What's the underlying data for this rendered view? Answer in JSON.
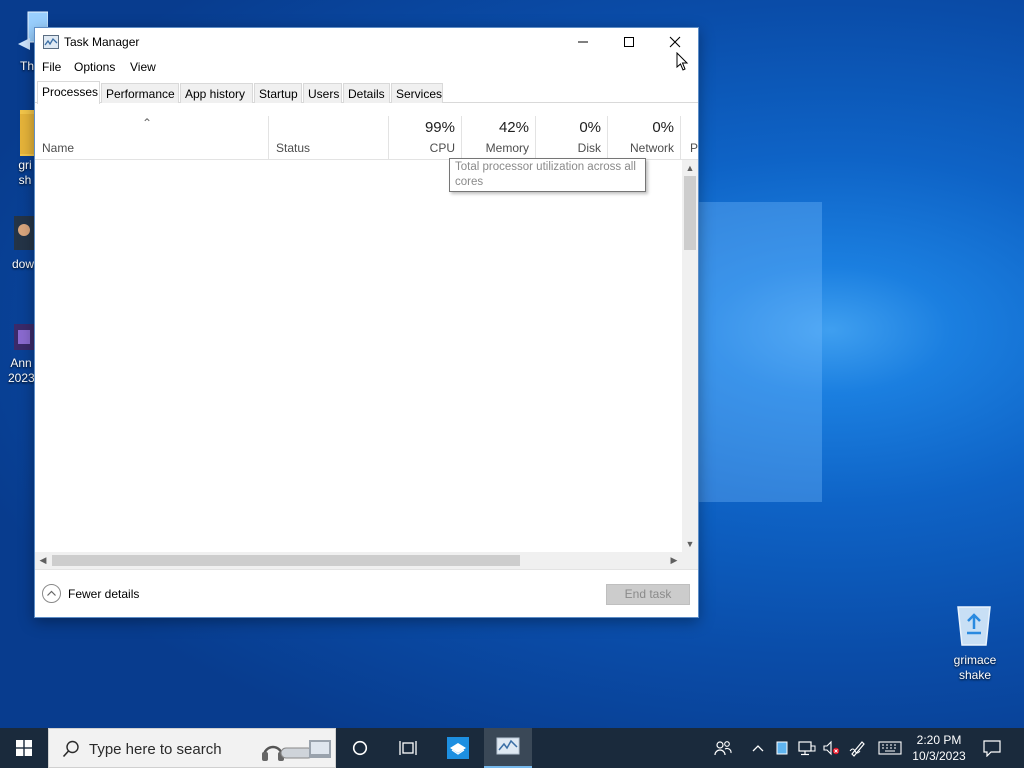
{
  "window": {
    "title": "Task Manager",
    "controls": {
      "minimize": "minimize",
      "maximize": "maximize",
      "close": "close"
    }
  },
  "menu": [
    "File",
    "Options",
    "View"
  ],
  "tabs": [
    "Processes",
    "Performance",
    "App history",
    "Startup",
    "Users",
    "Details",
    "Services"
  ],
  "active_tab": "Processes",
  "columns": {
    "name": "Name",
    "status": "Status",
    "cpu": {
      "pct": "99%",
      "label": "CPU"
    },
    "memory": {
      "pct": "42%",
      "label": "Memory"
    },
    "disk": {
      "pct": "0%",
      "label": "Disk"
    },
    "network": {
      "pct": "0%",
      "label": "Network"
    },
    "power_partial": "P"
  },
  "tooltip": "Total processor utilization across all cores",
  "footer": {
    "fewer_details": "Fewer details",
    "end_task": "End task"
  },
  "desktop": {
    "icons_left": [
      "Th",
      "gri\nsh",
      "dow",
      "Ann\n2023"
    ],
    "recycle_bin": "grimace\nshake"
  },
  "taskbar": {
    "search_placeholder": "Type here to search",
    "clock_time": "2:20 PM",
    "clock_date": "10/3/2023"
  },
  "colors": {
    "desktop_blue": "#0e63c6",
    "taskbar": "#1a2a3c",
    "accent": "#76b9ed"
  }
}
